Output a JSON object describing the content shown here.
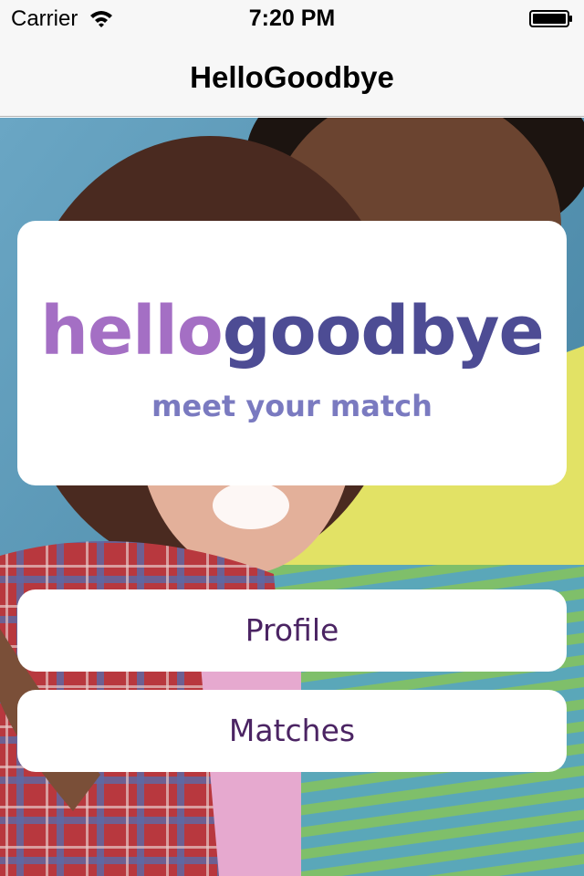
{
  "status_bar": {
    "carrier": "Carrier",
    "time": "7:20 PM",
    "icons": [
      "wifi-icon",
      "battery-icon"
    ]
  },
  "nav_bar": {
    "title": "HelloGoodbye"
  },
  "logo": {
    "hello": "hello",
    "goodbye": "goodbye",
    "tagline": "meet your match",
    "colors": {
      "hello": "#a46fc4",
      "goodbye": "#4d4c94",
      "tagline": "#7a7ac0"
    }
  },
  "menu": {
    "profile_label": "Profile",
    "matches_label": "Matches",
    "text_color": "#4b2463"
  }
}
